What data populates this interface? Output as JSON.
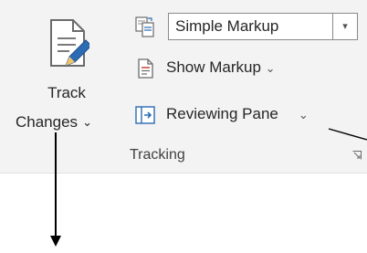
{
  "ribbon": {
    "track_changes": {
      "label_line1": "Track",
      "label_line2": "Changes",
      "dropdown_chevron": "⌄",
      "icon": "track-changes-icon"
    },
    "display_for_review": {
      "selected_value": "Simple Markup",
      "dropdown_arrow": "▾",
      "icon": "display-for-review-icon"
    },
    "show_markup": {
      "label": "Show Markup",
      "chevron": "⌄",
      "icon": "show-markup-icon"
    },
    "reviewing_pane": {
      "label": "Reviewing Pane",
      "chevron": "⌄",
      "icon": "reviewing-pane-icon"
    },
    "group_label": "Tracking",
    "dialog_launcher_icon": "dialog-launcher-icon"
  },
  "colors": {
    "ribbon_bg": "#f3f3f3",
    "accent_blue": "#2b6cb4",
    "text": "#262626",
    "arrow": "#000000"
  }
}
